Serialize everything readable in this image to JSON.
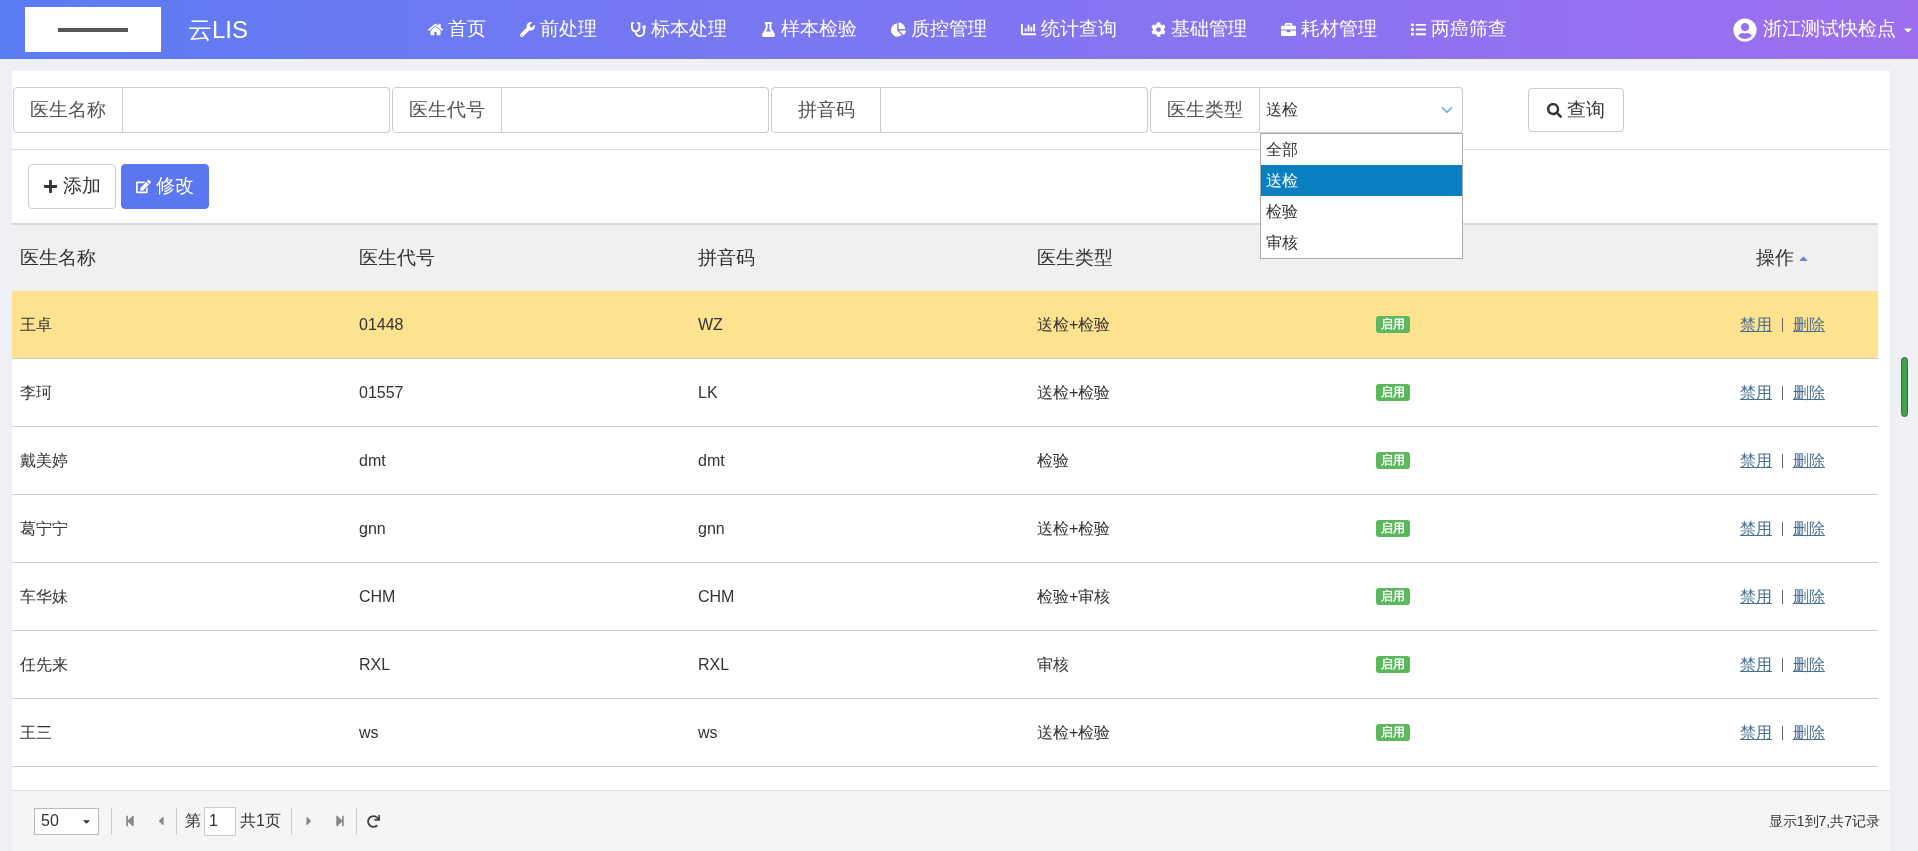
{
  "header": {
    "title": "云LIS",
    "nav": [
      {
        "label": "首页"
      },
      {
        "label": "前处理"
      },
      {
        "label": "标本处理"
      },
      {
        "label": "样本检验"
      },
      {
        "label": "质控管理"
      },
      {
        "label": "统计查询"
      },
      {
        "label": "基础管理"
      },
      {
        "label": "耗材管理"
      },
      {
        "label": "两癌筛查"
      }
    ],
    "user": "浙江测试快检点"
  },
  "filters": [
    {
      "label": "医生名称",
      "kind": "text"
    },
    {
      "label": "医生代号",
      "kind": "text"
    },
    {
      "label": "拼音码",
      "kind": "text"
    },
    {
      "label": "医生类型",
      "kind": "select",
      "value": "送检",
      "options": [
        {
          "label": "全部",
          "selected": false
        },
        {
          "label": "送检",
          "selected": true
        },
        {
          "label": "检验",
          "selected": false
        },
        {
          "label": "审核",
          "selected": false
        }
      ]
    }
  ],
  "search_button": "查询",
  "toolbar": [
    {
      "label": "添加",
      "kind": "add"
    },
    {
      "label": "修改",
      "kind": "edit"
    }
  ],
  "table": {
    "columns": [
      "医生名称",
      "医生代号",
      "拼音码",
      "医生类型",
      "操作"
    ],
    "rows": [
      {
        "selected": true,
        "cells": [
          "王卓",
          "01448",
          "WZ",
          "送检+检验"
        ],
        "status": "启用",
        "actions": [
          "禁用",
          "删除"
        ]
      },
      {
        "selected": false,
        "cells": [
          "李珂",
          "01557",
          "LK",
          "送检+检验"
        ],
        "status": "启用",
        "actions": [
          "禁用",
          "删除"
        ]
      },
      {
        "selected": false,
        "cells": [
          "戴美婷",
          "dmt",
          "dmt",
          "检验"
        ],
        "status": "启用",
        "actions": [
          "禁用",
          "删除"
        ]
      },
      {
        "selected": false,
        "cells": [
          "葛宁宁",
          "gnn",
          "gnn",
          "送检+检验"
        ],
        "status": "启用",
        "actions": [
          "禁用",
          "删除"
        ]
      },
      {
        "selected": false,
        "cells": [
          "车华妹",
          "CHM",
          "CHM",
          "检验+审核"
        ],
        "status": "启用",
        "actions": [
          "禁用",
          "删除"
        ]
      },
      {
        "selected": false,
        "cells": [
          "任先来",
          "RXL",
          "RXL",
          "审核"
        ],
        "status": "启用",
        "actions": [
          "禁用",
          "删除"
        ]
      },
      {
        "selected": false,
        "cells": [
          "王三",
          "ws",
          "ws",
          "送检+检验"
        ],
        "status": "启用",
        "actions": [
          "禁用",
          "删除"
        ]
      }
    ]
  },
  "pagination": {
    "page_size": "50",
    "page_prefix": "第",
    "page": "1",
    "page_total": "共1页",
    "summary": "显示1到7,共7记录"
  }
}
